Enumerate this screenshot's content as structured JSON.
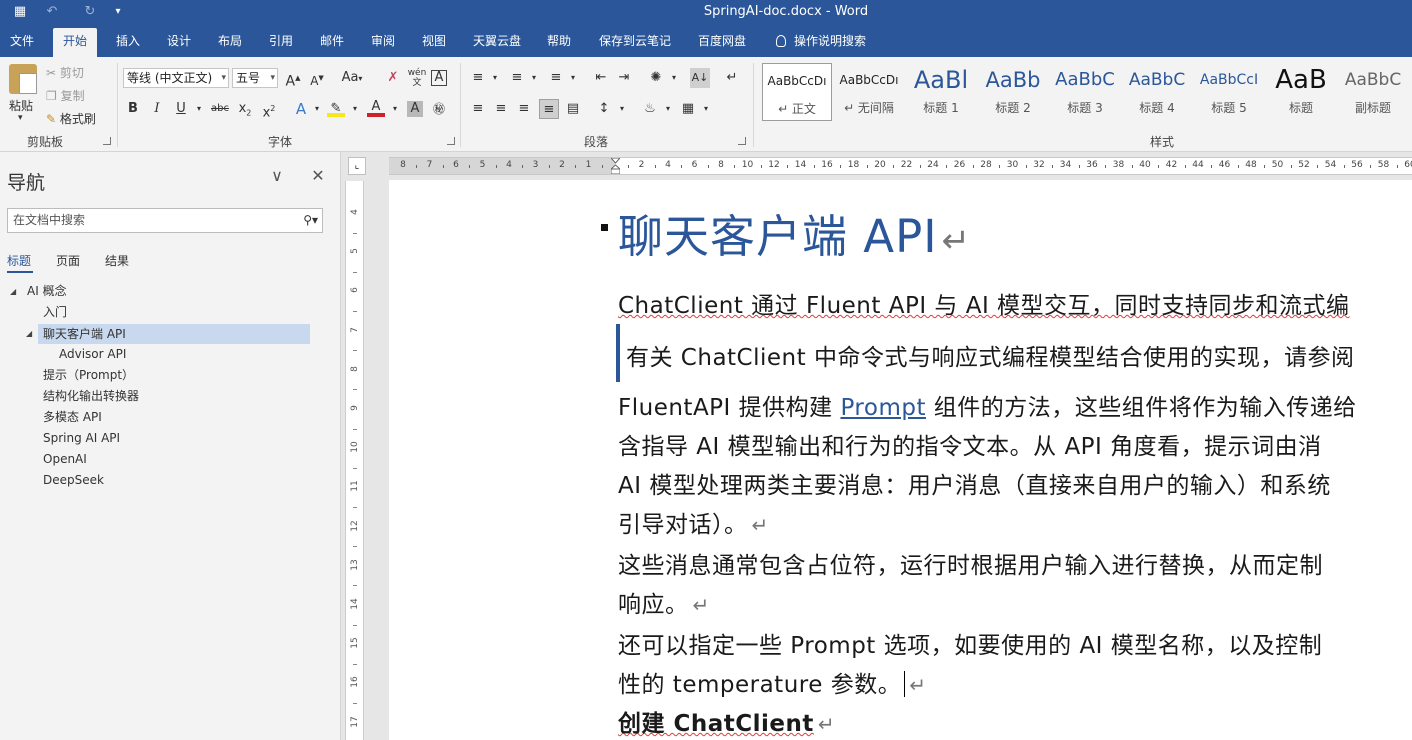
{
  "window": {
    "title": "SpringAI-doc.docx  -  Word",
    "quick_access": [
      "save-icon",
      "undo-icon",
      "redo-icon",
      "customize-icon"
    ]
  },
  "tabs": [
    "文件",
    "开始",
    "插入",
    "设计",
    "布局",
    "引用",
    "邮件",
    "审阅",
    "视图",
    "天翼云盘",
    "帮助",
    "保存到云笔记",
    "百度网盘",
    "操作说明搜索"
  ],
  "active_tab": "开始",
  "ribbon": {
    "clipboard": {
      "paste": "粘贴",
      "cut": "剪切",
      "copy": "复制",
      "format_painter": "格式刷",
      "label": "剪贴板"
    },
    "font": {
      "font_name": "等线 (中文正文)",
      "font_size": "五号",
      "label": "字体",
      "case_label": "Aa"
    },
    "paragraph": {
      "label": "段落"
    },
    "styles": {
      "label": "样式",
      "items": [
        {
          "sample": "AaBbCcDı",
          "name": "↵ 正文"
        },
        {
          "sample": "AaBbCcDı",
          "name": "↵ 无间隔"
        },
        {
          "sample": "AaBl",
          "name": "标题 1"
        },
        {
          "sample": "AaBb",
          "name": "标题 2"
        },
        {
          "sample": "AaBbC",
          "name": "标题 3"
        },
        {
          "sample": "AaBbC",
          "name": "标题 4"
        },
        {
          "sample": "AaBbCcI",
          "name": "标题 5"
        },
        {
          "sample": "AaB",
          "name": "标题"
        },
        {
          "sample": "AaBbC",
          "name": "副标题"
        }
      ]
    }
  },
  "nav": {
    "title": "导航",
    "search_placeholder": "在文档中搜索",
    "tabs": [
      "标题",
      "页面",
      "结果"
    ],
    "items": [
      "AI 概念",
      "入门",
      "聊天客户端 API",
      "Advisor API",
      "提示（Prompt）",
      "结构化输出转换器",
      "多模态 API",
      "Spring AI API",
      "OpenAI",
      "DeepSeek"
    ]
  },
  "ruler": {
    "h_left": [
      "8",
      "7",
      "6",
      "5",
      "4",
      "3",
      "2",
      "1"
    ],
    "h_right": [
      "2",
      "4",
      "6",
      "8",
      "10",
      "12",
      "14",
      "16",
      "18",
      "20",
      "22",
      "24",
      "26",
      "28",
      "30",
      "32",
      "34",
      "36",
      "38",
      "40",
      "42",
      "44",
      "46",
      "48",
      "50",
      "52",
      "54",
      "56",
      "58",
      "60"
    ],
    "v": [
      "4",
      "5",
      "6",
      "7",
      "8",
      "9",
      "10",
      "11",
      "12",
      "13",
      "14",
      "15",
      "16",
      "17"
    ]
  },
  "document": {
    "heading": "聊天客户端 API",
    "p1": "ChatClient 通过 Fluent API 与 AI 模型交互，同时支持同步和流式编",
    "quote": "有关 ChatClient 中命令式与响应式编程模型结合使用的实现，请参阅",
    "p2_a": "FluentAPI 提供构建 ",
    "p2_link": "Prompt",
    "p2_b": " 组件的方法，这些组件将作为输入传递给",
    "p2_line2": "含指导 AI 模型输出和行为的指令文本。从 API 角度看，提示词由消",
    "p2_line3": "AI 模型处理两类主要消息：用户消息（直接来自用户的输入）和系统",
    "p2_line4": "引导对话）。",
    "p3_line1": "这些消息通常包含占位符，运行时根据用户输入进行替换，从而定制",
    "p3_line2": "响应。",
    "p4_line1": "还可以指定一些 Prompt 选项，如要使用的 AI 模型名称，以及控制",
    "p4_line2": "性的 temperature 参数。",
    "h2": "创建 ChatClient",
    "paragraph_mark": "↵"
  }
}
